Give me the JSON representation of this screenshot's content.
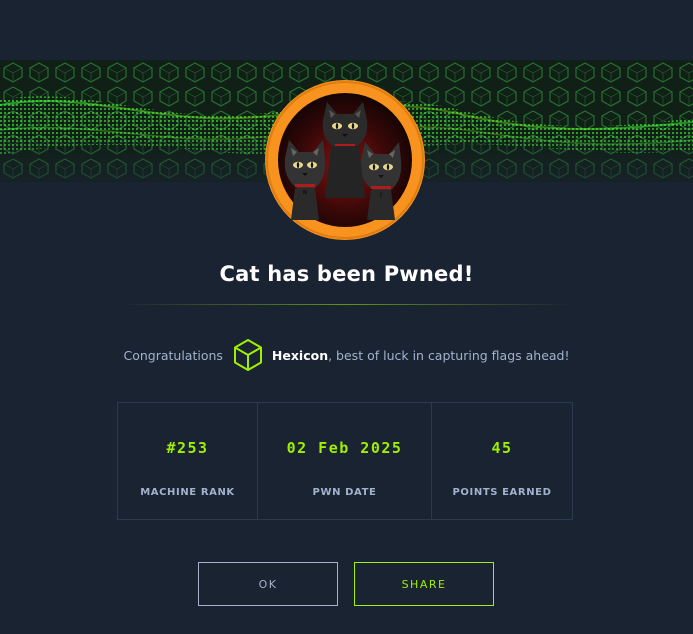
{
  "dialog": {
    "title": "Cat has been Pwned!",
    "congrats_prefix": "Congratulations",
    "username": "Hexicon",
    "congrats_suffix": ", best of luck in capturing flags ahead!",
    "machine_name": "Cat"
  },
  "stats": [
    {
      "value": "#253",
      "label": "MACHINE RANK"
    },
    {
      "value": "02 Feb 2025",
      "label": "PWN DATE"
    },
    {
      "value": "45",
      "label": "POINTS EARNED"
    }
  ],
  "buttons": {
    "ok_label": "OK",
    "share_label": "SHARE"
  },
  "icons": {
    "user_rank": "cube-icon",
    "machine_avatar": "cat-machine-avatar"
  },
  "colors": {
    "background": "#1a2332",
    "accent": "#9fef00",
    "text_muted": "#a4b1cd",
    "avatar_ring": "#f7931e",
    "border": "#2c3a4f"
  }
}
